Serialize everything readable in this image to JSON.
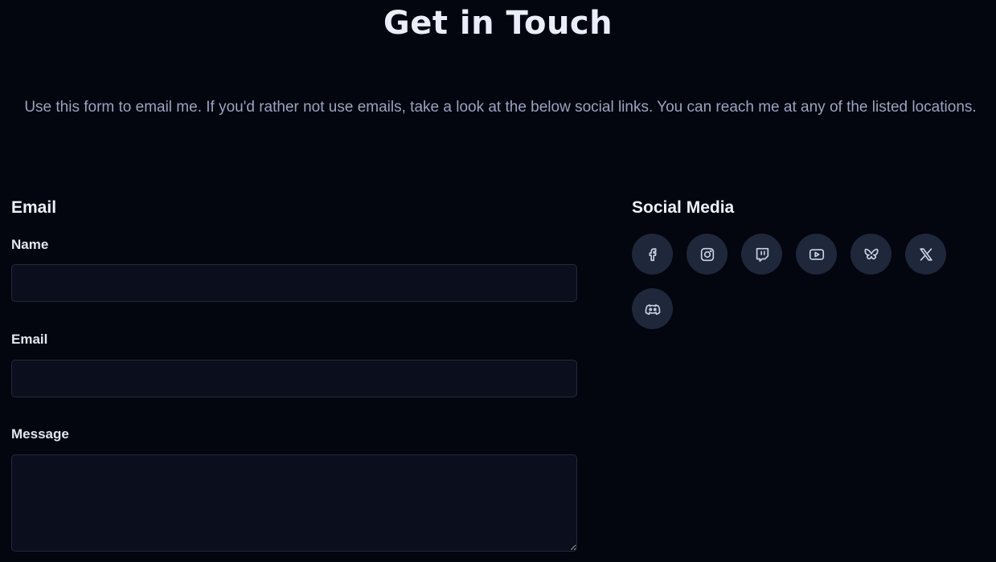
{
  "page": {
    "title": "Get in Touch",
    "intro": "Use this form to email me. If you'd rather not use emails, take a look at the below social links. You can reach me at any of the listed locations."
  },
  "email_form": {
    "heading": "Email",
    "fields": {
      "name": {
        "label": "Name",
        "value": "",
        "placeholder": ""
      },
      "email": {
        "label": "Email",
        "value": "",
        "placeholder": ""
      },
      "message": {
        "label": "Message",
        "value": "",
        "placeholder": ""
      }
    }
  },
  "social": {
    "heading": "Social Media",
    "links": [
      {
        "icon": "facebook-icon"
      },
      {
        "icon": "instagram-icon"
      },
      {
        "icon": "twitch-icon"
      },
      {
        "icon": "youtube-icon"
      },
      {
        "icon": "bluesky-icon"
      },
      {
        "icon": "x-icon"
      },
      {
        "icon": "discord-icon"
      }
    ]
  },
  "colors": {
    "background": "#03050f",
    "input_background": "#0b0f1d",
    "input_border": "#222a3c",
    "social_button": "#1e283a",
    "icon": "#c8d2e6",
    "muted_text": "#9aa4be"
  }
}
